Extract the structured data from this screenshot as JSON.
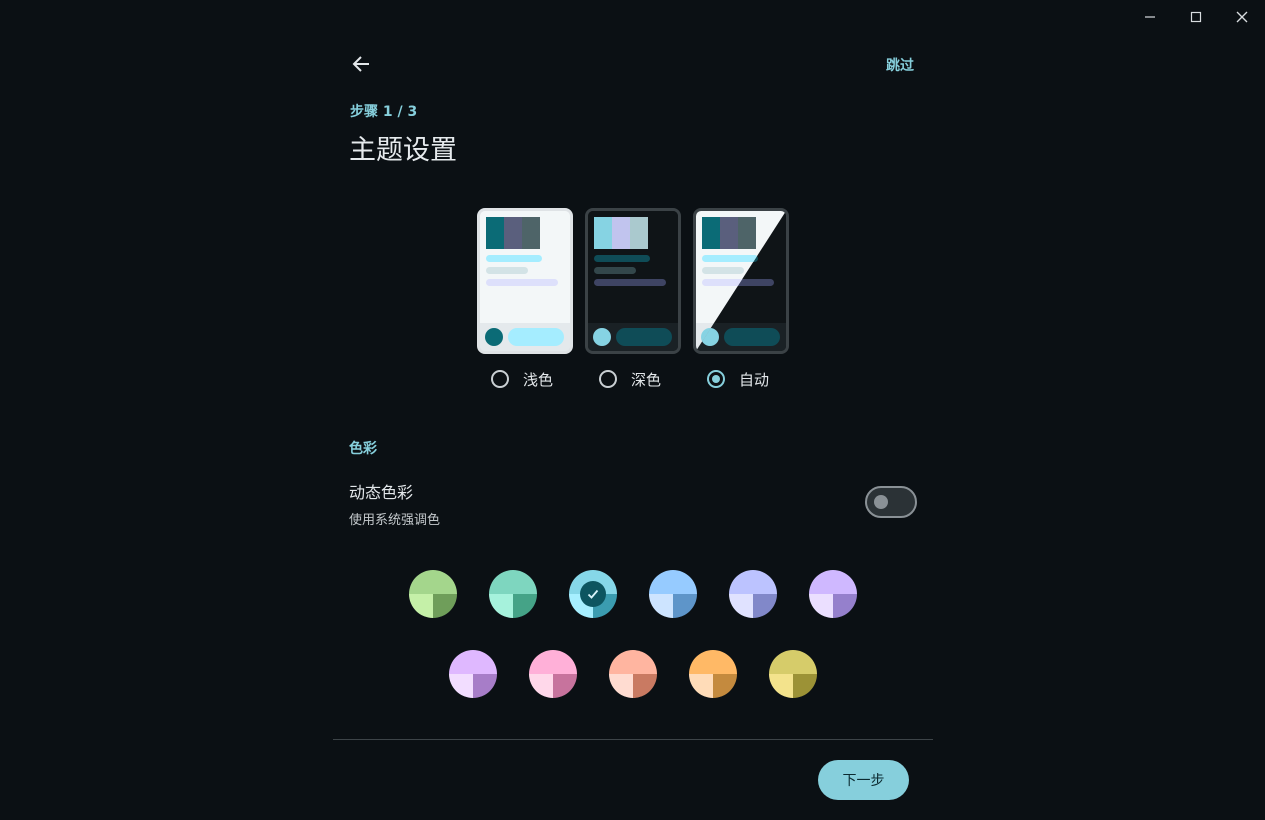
{
  "window_controls": {
    "minimize_icon": "minimize-icon",
    "maximize_icon": "maximize-icon",
    "close_icon": "close-icon"
  },
  "header": {
    "back_icon": "arrow-left-icon",
    "skip_label": "跳过",
    "step_label": "步骤 1 / 3",
    "title": "主题设置"
  },
  "theme": {
    "options": [
      {
        "label": "浅色",
        "selected": false
      },
      {
        "label": "深色",
        "selected": false
      },
      {
        "label": "自动",
        "selected": true
      }
    ]
  },
  "color_section": {
    "title": "色彩",
    "dynamic_color_title": "动态色彩",
    "dynamic_color_subtitle": "使用系统强调色",
    "dynamic_color_enabled": false
  },
  "swatches": [
    {
      "name": "green",
      "top": "#a4d68c",
      "bl": "#c5f0a8",
      "br": "#6f9e5a",
      "selected": false
    },
    {
      "name": "teal",
      "top": "#7ed6bf",
      "bl": "#a6f2dc",
      "br": "#45a387",
      "selected": false
    },
    {
      "name": "cyan",
      "top": "#86d7e8",
      "bl": "#a7efff",
      "br": "#3b9cb0",
      "selected": true
    },
    {
      "name": "blue",
      "top": "#96cbff",
      "bl": "#cde4ff",
      "br": "#5e95c9",
      "selected": false
    },
    {
      "name": "indigo",
      "top": "#bcc3ff",
      "bl": "#e0e2ff",
      "br": "#8188c9",
      "selected": false
    },
    {
      "name": "purple",
      "top": "#cfb8ff",
      "bl": "#ebdfff",
      "br": "#9580cc",
      "selected": false
    },
    {
      "name": "violet",
      "top": "#dfb8ff",
      "bl": "#f2ddff",
      "br": "#a77dc8",
      "selected": false
    },
    {
      "name": "pink",
      "top": "#ffb0d8",
      "bl": "#ffd8ea",
      "br": "#c7739d",
      "selected": false
    },
    {
      "name": "salmon",
      "top": "#ffb5a0",
      "bl": "#ffdcd1",
      "br": "#c97a62",
      "selected": false
    },
    {
      "name": "orange",
      "top": "#ffb966",
      "bl": "#ffdcb8",
      "br": "#c48a3e",
      "selected": false
    },
    {
      "name": "olive",
      "top": "#d6cc6a",
      "bl": "#f3e38c",
      "br": "#9c9236",
      "selected": false
    }
  ],
  "footer": {
    "next_label": "下一步"
  },
  "colors": {
    "background": "#0b1014",
    "accent": "#86cfdc"
  }
}
